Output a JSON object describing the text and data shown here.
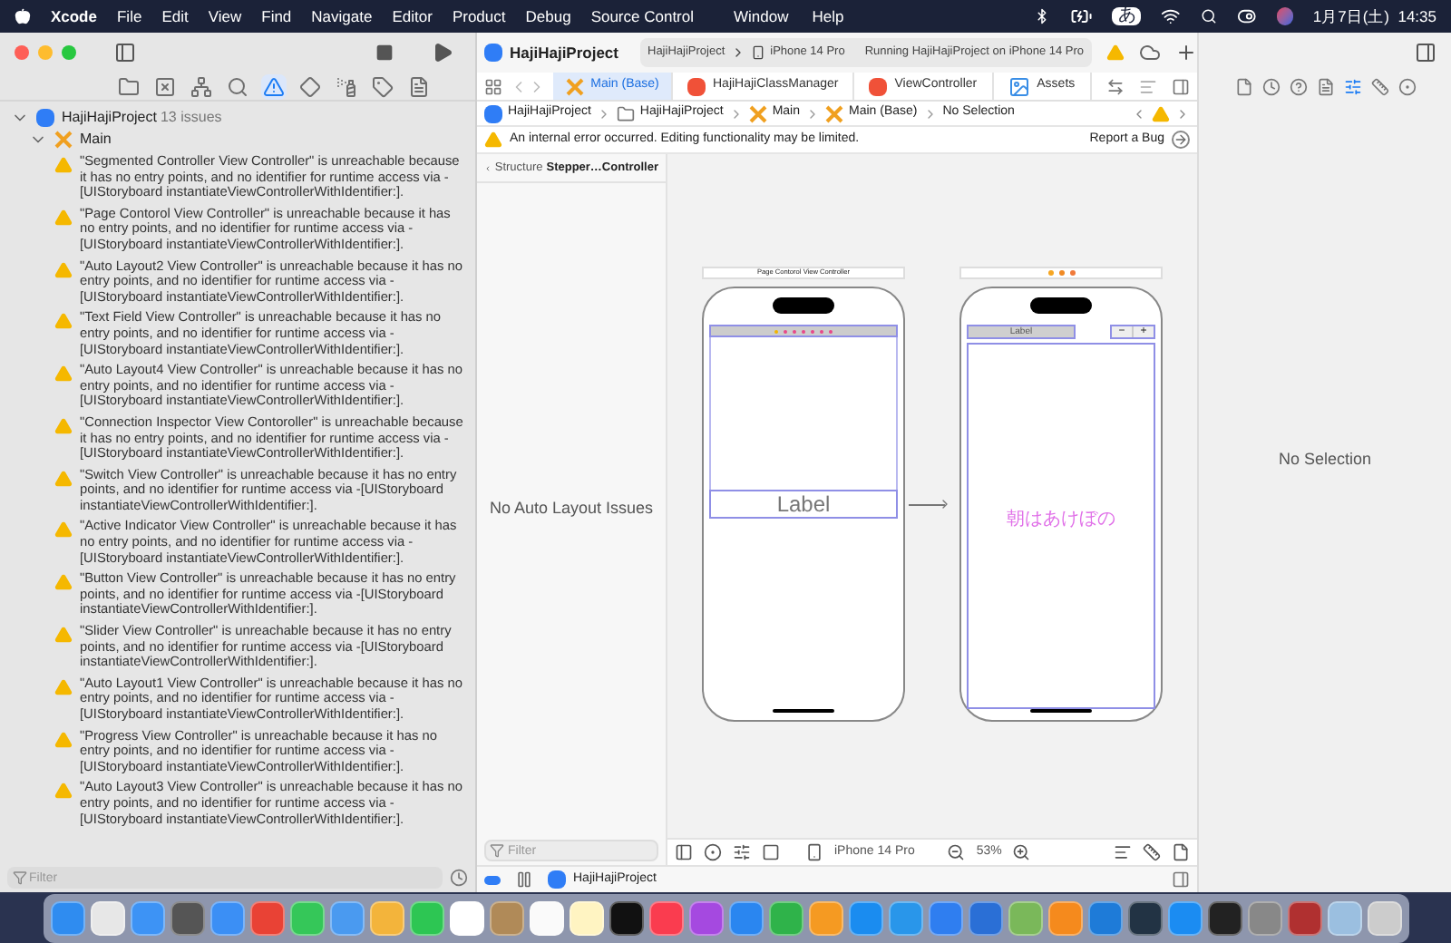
{
  "menu_bar": {
    "items": [
      {
        "label": "Xcode",
        "bold": true
      },
      {
        "label": "File",
        "bold": false
      },
      {
        "label": "Edit",
        "bold": false
      },
      {
        "label": "View",
        "bold": false
      },
      {
        "label": "Find",
        "bold": false
      },
      {
        "label": "Navigate",
        "bold": false
      },
      {
        "label": "Editor",
        "bold": false
      },
      {
        "label": "Product",
        "bold": false
      },
      {
        "label": "Debug",
        "bold": false
      },
      {
        "label": "Source Control",
        "bold": false
      },
      {
        "label": "Window",
        "bold": false
      },
      {
        "label": "Help",
        "bold": false
      }
    ],
    "input_method": "あ",
    "clock": "1月7日(土)  14:35"
  },
  "toolbar": {
    "project": "HajiHajiProject",
    "scheme": "HajiHajiProject",
    "device": "iPhone 14 Pro",
    "status": "Running HajiHajiProject on iPhone 14 Pro"
  },
  "navigator": {
    "tabs": [
      {
        "kind": "folder",
        "selected": false
      },
      {
        "kind": "source",
        "selected": false
      },
      {
        "kind": "hierarchy",
        "selected": false
      },
      {
        "kind": "search",
        "selected": false
      },
      {
        "kind": "issues",
        "selected": true
      },
      {
        "kind": "tests",
        "selected": false
      },
      {
        "kind": "debug",
        "selected": false
      },
      {
        "kind": "breakpoints",
        "selected": false
      },
      {
        "kind": "reports",
        "selected": false
      }
    ],
    "project": {
      "name": "HajiHajiProject",
      "count": "13 issues",
      "expanded": true
    },
    "group": {
      "name": "Main",
      "expanded": true
    },
    "issues": [
      "\"Segmented Controller View Controller\" is unreachable because it has no entry points, and no identifier for runtime access via -[UIStoryboard instantiateViewControllerWithIdentifier:].",
      "\"Page Contorol View Controller\" is unreachable because it has no entry points, and no identifier for runtime access via -[UIStoryboard instantiateViewControllerWithIdentifier:].",
      "\"Auto Layout2 View Controller\" is unreachable because it has no entry points, and no identifier for runtime access via -[UIStoryboard instantiateViewControllerWithIdentifier:].",
      "\"Text Field View Controller\" is unreachable because it has no entry points, and no identifier for runtime access via -[UIStoryboard instantiateViewControllerWithIdentifier:].",
      "\"Auto Layout4 View Controller\" is unreachable because it has no entry points, and no identifier for runtime access via -[UIStoryboard instantiateViewControllerWithIdentifier:].",
      "\"Connection Inspector View Contoroller\" is unreachable because it has no entry points, and no identifier for runtime access via -[UIStoryboard instantiateViewControllerWithIdentifier:].",
      "\"Switch View Controller\" is unreachable because it has no entry points, and no identifier for runtime access via -[UIStoryboard instantiateViewControllerWithIdentifier:].",
      "\"Active Indicator View Controller\" is unreachable because it has no entry points, and no identifier for runtime access via -[UIStoryboard instantiateViewControllerWithIdentifier:].",
      "\"Button View Controller\" is unreachable because it has no entry points, and no identifier for runtime access via -[UIStoryboard instantiateViewControllerWithIdentifier:].",
      "\"Slider View Controller\" is unreachable because it has no entry points, and no identifier for runtime access via -[UIStoryboard instantiateViewControllerWithIdentifier:].",
      "\"Auto Layout1 View Controller\" is unreachable because it has no entry points, and no identifier for runtime access via -[UIStoryboard instantiateViewControllerWithIdentifier:].",
      "\"Progress View Controller\" is unreachable because it has no entry points, and no identifier for runtime access via -[UIStoryboard instantiateViewControllerWithIdentifier:].",
      "\"Auto Layout3 View Controller\" is unreachable because it has no entry points, and no identifier for runtime access via -[UIStoryboard instantiateViewControllerWithIdentifier:]."
    ],
    "filter_placeholder": "Filter"
  },
  "editor": {
    "tabs": [
      {
        "label": "Main (Base)",
        "kind": "storyboard",
        "selected": true
      },
      {
        "label": "HajiHajiClassManager",
        "kind": "swift",
        "selected": false
      },
      {
        "label": "ViewController",
        "kind": "swift",
        "selected": false
      },
      {
        "label": "Assets",
        "kind": "assets",
        "selected": false
      }
    ],
    "breadcrumb": [
      {
        "label": "HajiHajiProject",
        "kind": "project"
      },
      {
        "label": "HajiHajiProject",
        "kind": "folder"
      },
      {
        "label": "Main",
        "kind": "storyboard"
      },
      {
        "label": "Main (Base)",
        "kind": "storyboard"
      },
      {
        "label": "No Selection",
        "kind": "none"
      }
    ],
    "banner": {
      "message": "An internal error occurred. Editing functionality may be limited.",
      "action": "Report a Bug"
    },
    "structure": {
      "back": "Structure",
      "title": "Stepper…Controller",
      "message": "No Auto Layout Issues",
      "filter_placeholder": "Filter"
    },
    "canvas": {
      "scene_1": {
        "title": "Page Contorol View Controller",
        "label": "Label"
      },
      "scene_2": {
        "label": "Label",
        "minus": "−",
        "plus": "+",
        "text": "朝はあけぼの"
      }
    },
    "bottom_bar": {
      "device": "iPhone 14 Pro",
      "zoom": "53%"
    },
    "debug_bar": {
      "breakpoints_on": true,
      "target": "HajiHajiProject"
    }
  },
  "inspector": {
    "message": "No Selection"
  }
}
